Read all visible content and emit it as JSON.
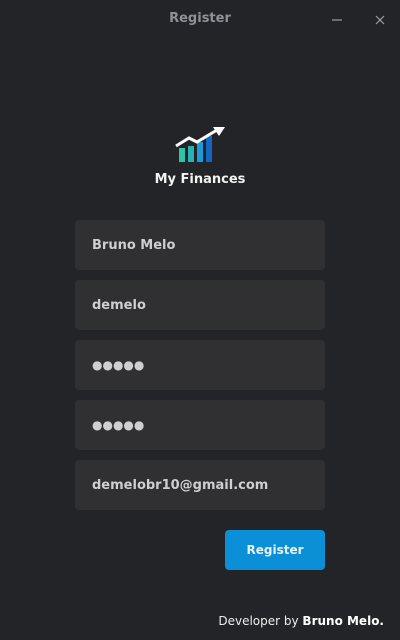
{
  "window": {
    "title": "Register",
    "minimize_icon": "minimize-icon",
    "close_icon": "close-icon"
  },
  "app": {
    "name": "My Finances",
    "logo_icon": "bar-chart-trend-up-icon",
    "logo_colors": [
      "#2ec4a5",
      "#1c9bd8",
      "#1466c0",
      "#ffffff"
    ]
  },
  "form": {
    "name_value": "Bruno Melo",
    "username_value": "demelo",
    "password_value": "●●●●●",
    "confirm_password_value": "●●●●●",
    "email_value": "demelobr10@gmail.com",
    "submit_label": "Register",
    "accent": "#0b8fd6"
  },
  "footer": {
    "prefix": "Developer by ",
    "author": "Bruno Melo."
  }
}
